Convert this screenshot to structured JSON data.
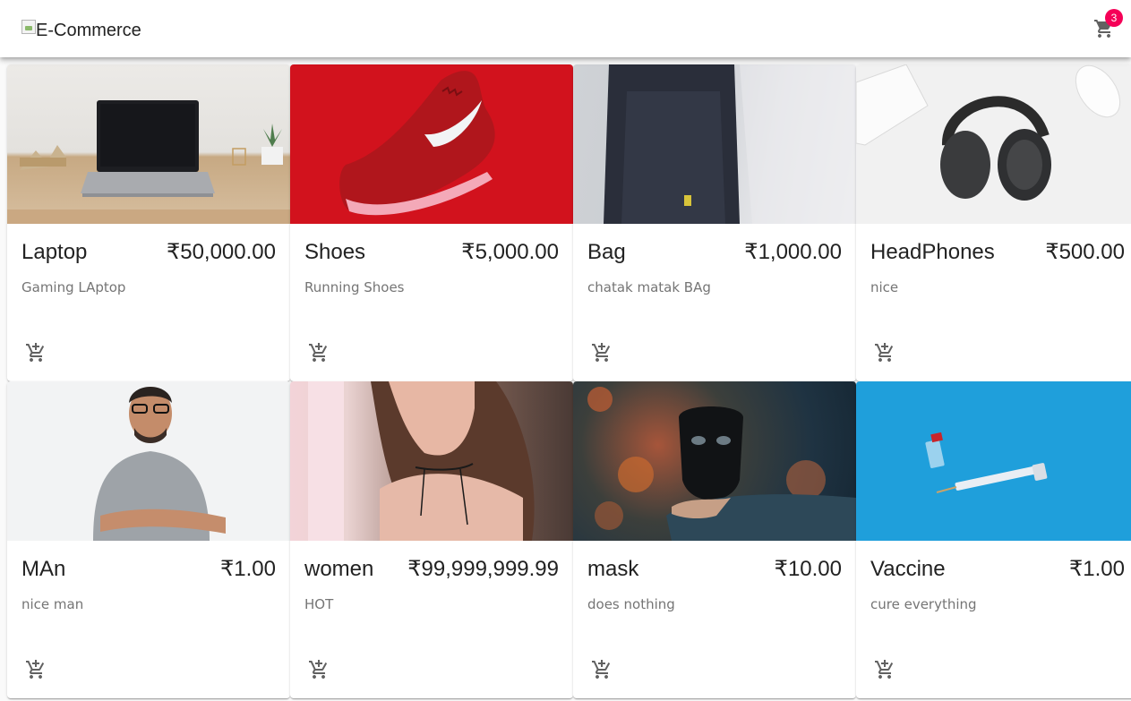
{
  "header": {
    "logo_alt": "E-Commerce",
    "cart_count": "3"
  },
  "products": [
    {
      "name": "Laptop",
      "price": "₹50,000.00",
      "description": "Gaming LAptop"
    },
    {
      "name": "Shoes",
      "price": "₹5,000.00",
      "description": "Running Shoes"
    },
    {
      "name": "Bag",
      "price": "₹1,000.00",
      "description": "chatak matak BAg"
    },
    {
      "name": "HeadPhones",
      "price": "₹500.00",
      "description": "nice"
    },
    {
      "name": "MAn",
      "price": "₹1.00",
      "description": "nice man"
    },
    {
      "name": "women",
      "price": "₹99,999,999.99",
      "description": "HOT"
    },
    {
      "name": "mask",
      "price": "₹10.00",
      "description": "does nothing"
    },
    {
      "name": "Vaccine",
      "price": "₹1.00",
      "description": "cure everything"
    }
  ],
  "colors": {
    "badge": "#f50057",
    "icon": "#616161"
  },
  "icons": {
    "cart": "shopping-cart-icon",
    "add_to_cart": "add-shopping-cart-icon"
  }
}
